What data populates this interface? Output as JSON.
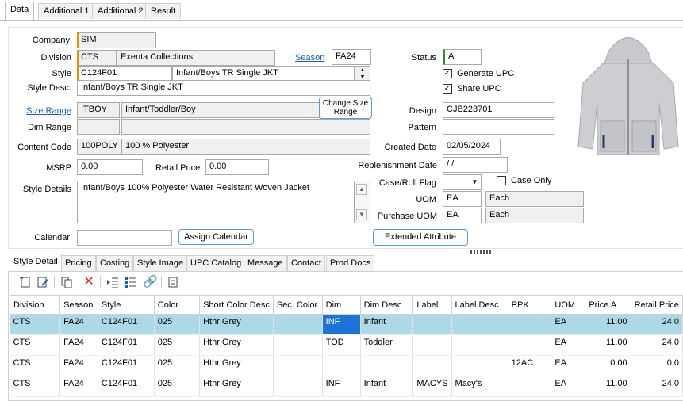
{
  "tabs": [
    "Data",
    "Additional 1",
    "Additional 2",
    "Result"
  ],
  "labels": {
    "company": "Company",
    "division": "Division",
    "style": "Style",
    "style_desc": "Style Desc.",
    "size_range": "Size Range",
    "dim_range": "Dim Range",
    "content_code": "Content Code",
    "msrp": "MSRP",
    "retail_price": "Retail Price",
    "style_details": "Style Details",
    "calendar": "Calendar",
    "season": "Season",
    "status": "Status",
    "design": "Design",
    "pattern": "Pattern",
    "created_date": "Created Date",
    "replenishment_date": "Replenishment Date",
    "case_roll_flag": "Case/Roll Flag",
    "uom": "UOM",
    "purchase_uom": "Purchase UOM",
    "case_only": "Case Only",
    "generate_upc": "Generate UPC",
    "share_upc": "Share UPC"
  },
  "values": {
    "company": "SIM",
    "division_code": "CTS",
    "division_name": "Exenta Collections",
    "style_code": "C124F01",
    "style_name": "Infant/Boys TR Single JKT",
    "style_desc": "Infant/Boys TR Single JKT",
    "size_range_code": "ITBOY",
    "size_range_name": "Infant/Toddler/Boy",
    "dim_range_code": "",
    "dim_range_name": "",
    "content_code": "100POLY",
    "content_desc": "100 % Polyester",
    "msrp": "0.00",
    "retail_price": "0.00",
    "style_details": "Infant/Boys 100% Polyester Water Resistant Woven Jacket",
    "calendar": "",
    "season": "FA24",
    "status": "A",
    "design": "CJB223701",
    "pattern": "",
    "created_date": "02/05/2024",
    "replenishment_date": " / /",
    "case_roll_flag": "",
    "uom_code": "EA",
    "uom_name": "Each",
    "purchase_uom_code": "EA",
    "purchase_uom_name": "Each",
    "generate_upc": true,
    "share_upc": true,
    "case_only": false
  },
  "buttons": {
    "change_size_range": "Change Size Range",
    "assign_calendar": "Assign Calendar",
    "extended_attribute": "Extended Attribute"
  },
  "bottom_tabs": [
    "Style Detail",
    "Pricing",
    "Costing",
    "Style Image",
    "UPC Catalog",
    "Message",
    "Contact",
    "Prod Docs"
  ],
  "toolbar_icons": [
    "new-document-icon",
    "edit-document-icon",
    "copy-icon",
    "delete-icon",
    "indent-list-icon",
    "numbered-list-icon",
    "link-icon",
    "checklist-icon"
  ],
  "colors": {
    "accent": "#1a5fb4",
    "required": "#f08c00",
    "status": "#2e8b2e",
    "selected_row": "#add8e6",
    "selected_cell": "#1e73d6"
  },
  "grid": {
    "columns": [
      "Division",
      "Season",
      "Style",
      "Color",
      "Short Color Desc",
      "Sec. Color",
      "Dim",
      "Dim Desc",
      "Label",
      "Label Desc",
      "PPK",
      "UOM",
      "Price A",
      "Retail Price"
    ],
    "rows": [
      [
        "CTS",
        "FA24",
        "C124F01",
        "025",
        "Hthr Grey",
        "",
        "INF",
        "Infant",
        "",
        "",
        "",
        "EA",
        "11.00",
        "24.0"
      ],
      [
        "CTS",
        "FA24",
        "C124F01",
        "025",
        "Hthr Grey",
        "",
        "TOD",
        "Toddler",
        "",
        "",
        "",
        "EA",
        "11.00",
        "24.0"
      ],
      [
        "CTS",
        "FA24",
        "C124F01",
        "025",
        "Hthr Grey",
        "",
        "",
        "",
        "",
        "",
        "12AC",
        "EA",
        "0.00",
        "0.0"
      ],
      [
        "CTS",
        "FA24",
        "C124F01",
        "025",
        "Hthr Grey",
        "",
        "INF",
        "Infant",
        "MACYS",
        "Macy's",
        "",
        "EA",
        "11.00",
        "24.0"
      ]
    ]
  }
}
